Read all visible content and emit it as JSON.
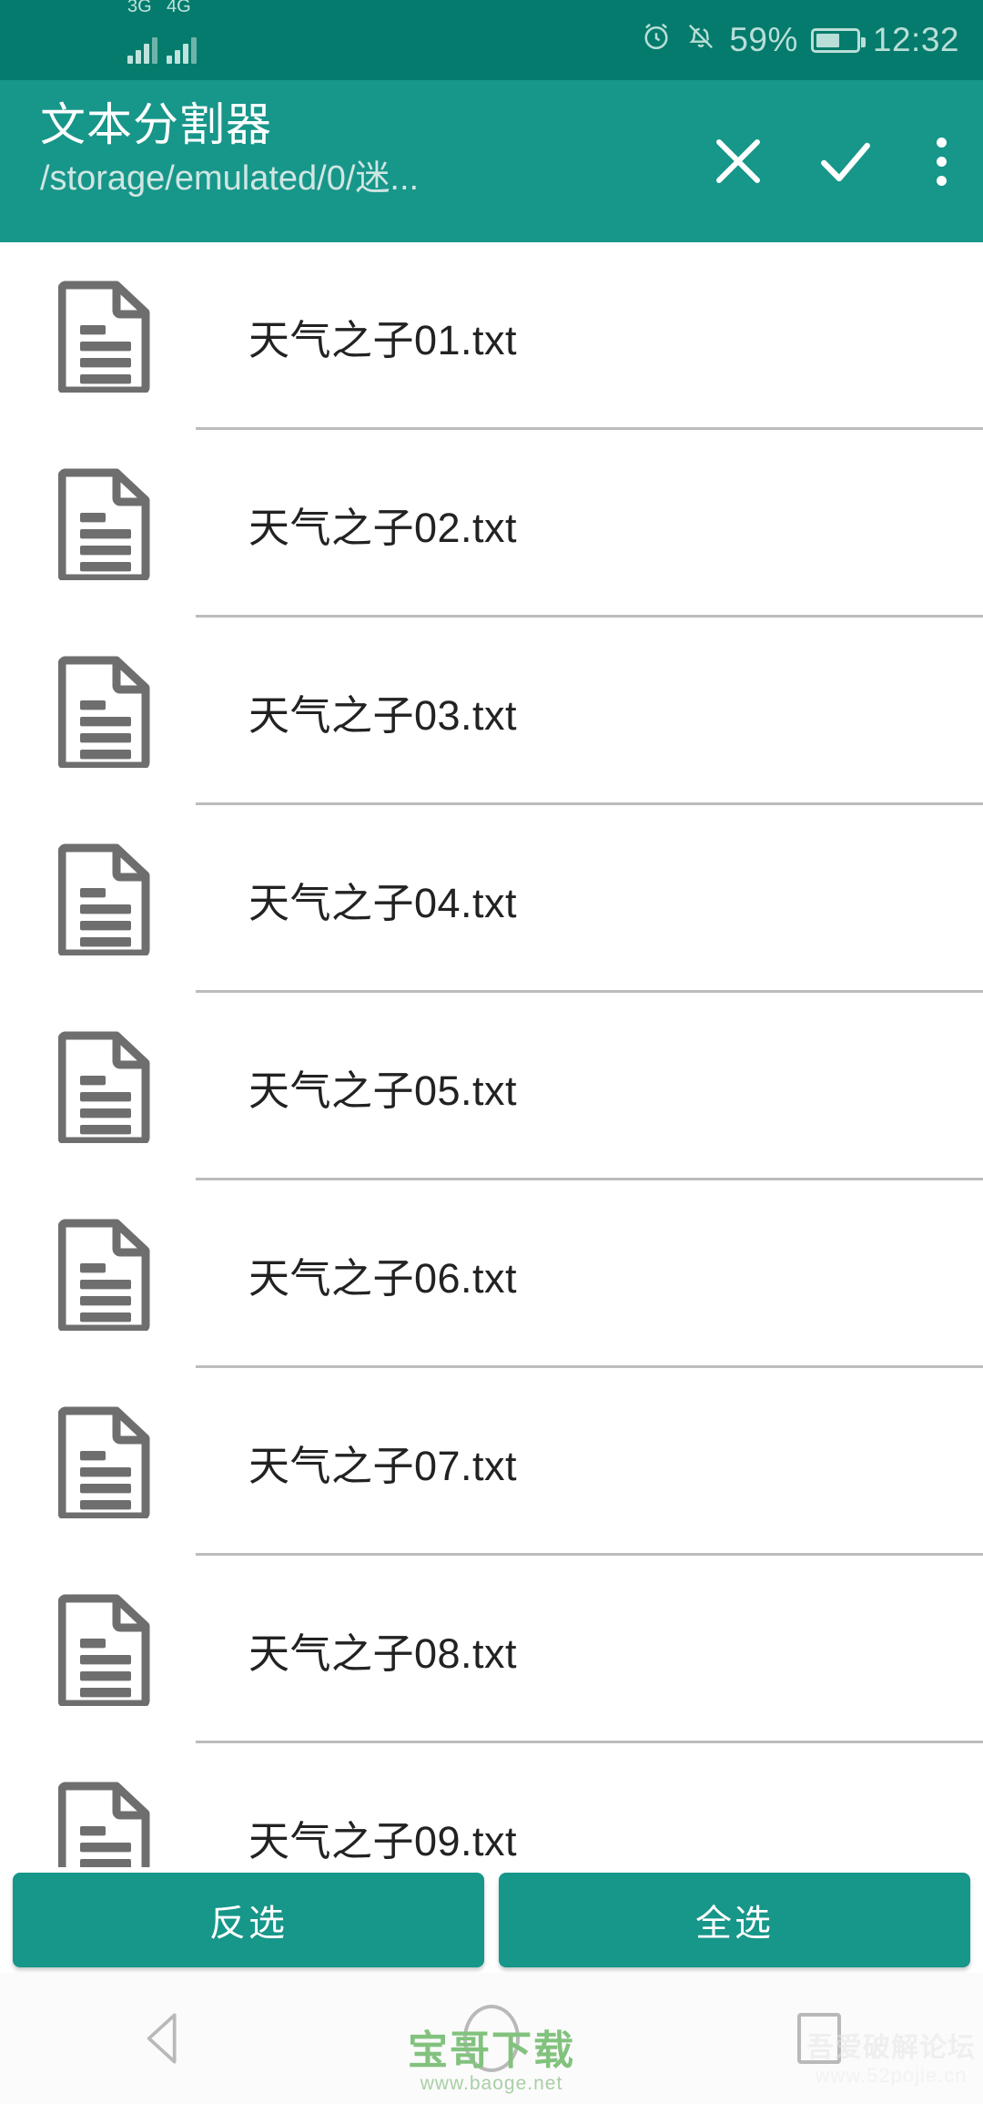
{
  "statusbar": {
    "signal_1_label": "3G",
    "signal_2_label": "4G",
    "battery_percent": "59%",
    "clock": "12:32",
    "alarm_icon": "alarm-clock-icon",
    "mute_icon": "bell-muted-icon",
    "battery_icon": "battery-icon"
  },
  "toolbar": {
    "title": "文本分割器",
    "subtitle": "/storage/emulated/0/迷...",
    "close_icon": "close-icon",
    "confirm_icon": "check-icon",
    "overflow_icon": "overflow-menu-icon"
  },
  "files": [
    {
      "name": "天气之子01.txt"
    },
    {
      "name": "天气之子02.txt"
    },
    {
      "name": "天气之子03.txt"
    },
    {
      "name": "天气之子04.txt"
    },
    {
      "name": "天气之子05.txt"
    },
    {
      "name": "天气之子06.txt"
    },
    {
      "name": "天气之子07.txt"
    },
    {
      "name": "天气之子08.txt"
    },
    {
      "name": "天气之子09.txt"
    }
  ],
  "bottom_bar": {
    "invert_label": "反选",
    "select_all_label": "全选"
  },
  "navbar": {
    "back_icon": "back-triangle-icon",
    "home_icon": "home-circle-icon",
    "recents_icon": "recents-square-icon"
  },
  "watermarks": {
    "center_text": "宝哥下载",
    "center_url": "www.baoge.net",
    "right_text": "吾爱破解论坛",
    "right_url": "www.52pojie.cn"
  },
  "colors": {
    "status_bar": "#047B6C",
    "toolbar": "#17968A",
    "accent_button": "#17968A",
    "divider": "#bcbcbc",
    "file_icon": "#6e6e6e"
  }
}
